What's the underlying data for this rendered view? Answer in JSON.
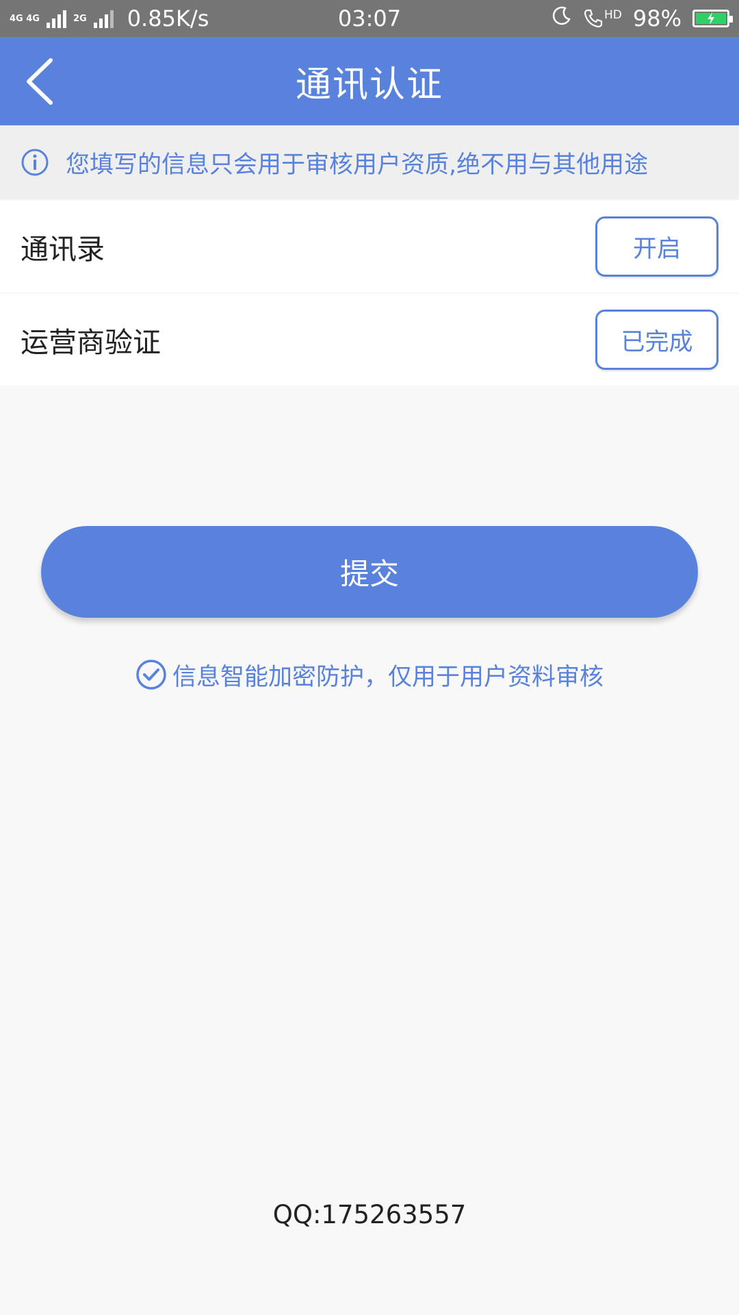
{
  "status_bar": {
    "network_top": "4G 4G",
    "network_2g": "2G",
    "speed": "0.85K/s",
    "time": "03:07",
    "hd_label": "HD",
    "battery": "98%",
    "battery_color": "#2fd067"
  },
  "header": {
    "title": "通讯认证",
    "back_icon": "chevron-left-icon",
    "background": "#5882db"
  },
  "notice": {
    "icon": "info-icon",
    "text": "您填写的信息只会用于审核用户资质,绝不用与其他用途"
  },
  "rows": [
    {
      "label": "通讯录",
      "button": "开启"
    },
    {
      "label": "运营商验证",
      "button": "已完成"
    }
  ],
  "submit": {
    "label": "提交"
  },
  "privacy": {
    "icon": "check-circle-icon",
    "text": "信息智能加密防护，仅用于用户资料审核"
  },
  "footer": {
    "qq": "QQ:175263557"
  }
}
